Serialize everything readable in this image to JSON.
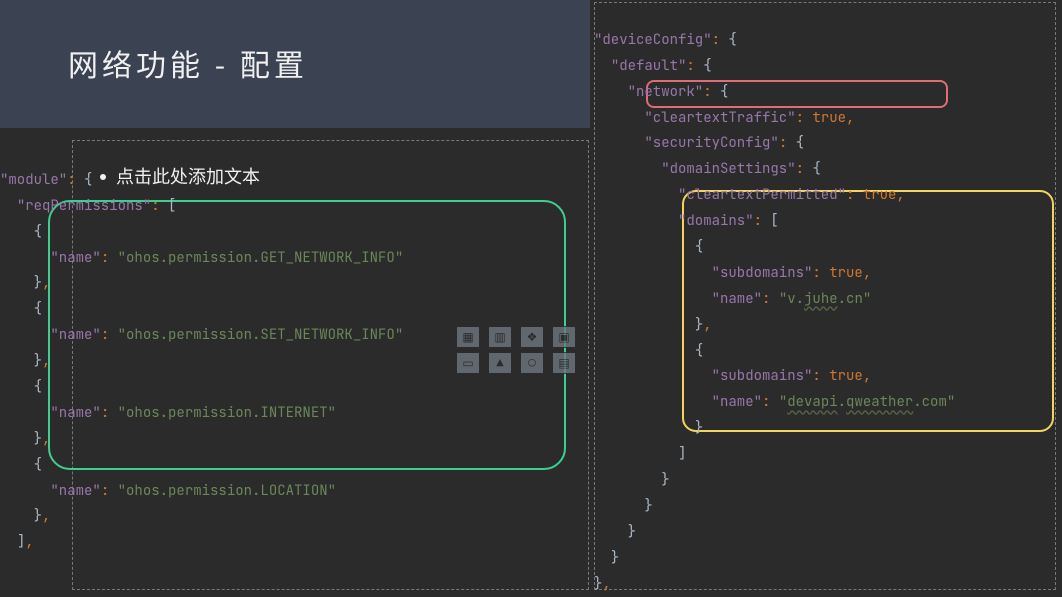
{
  "title": "网络功能  -  配置",
  "subtitle": "点击此处添加文本",
  "left": {
    "moduleKey": "\"module\"",
    "reqKey": "\"reqPermissions\"",
    "perms": [
      "\"ohos.permission.GET_NETWORK_INFO\"",
      "\"ohos.permission.SET_NETWORK_INFO\"",
      "\"ohos.permission.INTERNET\"",
      "\"ohos.permission.LOCATION\""
    ],
    "nameKey": "\"name\""
  },
  "right": {
    "deviceConfig": "\"deviceConfig\"",
    "default": "\"default\"",
    "network": "\"network\"",
    "cleartextTraffic": "\"cleartextTraffic\"",
    "securityConfig": "\"securityConfig\"",
    "domainSettings": "\"domainSettings\"",
    "cleartextPermitted": "\"cleartextPermitted\"",
    "domains": "\"domains\"",
    "subdomains": "\"subdomains\"",
    "name": "\"name\"",
    "trueVal": "true",
    "domain1_a": "\"v.",
    "domain1_b": "juhe",
    "domain1_c": ".cn\"",
    "domain2_a": "\"",
    "domain2_b": "devapi",
    "domain2_c": ".",
    "domain2_d": "qweather",
    "domain2_e": ".com\""
  }
}
